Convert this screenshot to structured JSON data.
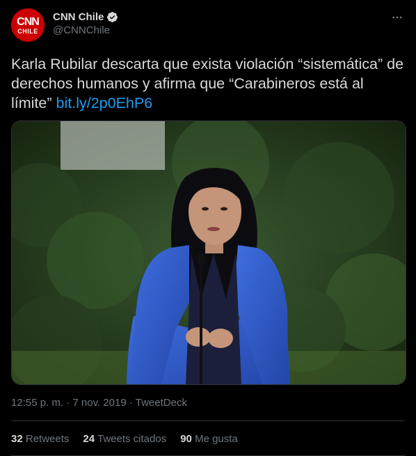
{
  "account": {
    "avatar_top": "CNN",
    "avatar_bottom": "CHILE",
    "display_name": "CNN Chile",
    "handle": "@CNNChile"
  },
  "tweet": {
    "text": "Karla Rubilar descarta que exista violación “sistemática” de derechos humanos y afirma que “Carabineros está al límite”",
    "link": "bit.ly/2p0EhP6",
    "time": "12:55 p. m.",
    "date": "7 nov. 2019",
    "source": "TweetDeck",
    "separator": " · "
  },
  "stats": {
    "retweets_count": "32",
    "retweets_label": "Retweets",
    "quotes_count": "24",
    "quotes_label": "Tweets citados",
    "likes_count": "90",
    "likes_label": "Me gusta"
  },
  "colors": {
    "background": "#000000",
    "link": "#1d9bf0",
    "brand_red": "#cc0000"
  },
  "icons": {
    "verified": "verified-badge-icon",
    "more": "more-options-icon"
  }
}
